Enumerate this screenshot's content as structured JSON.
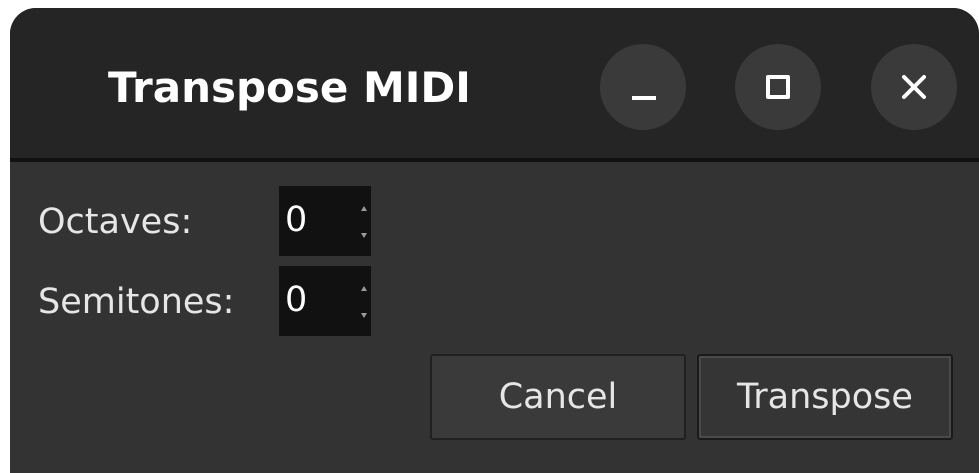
{
  "window": {
    "title": "Transpose MIDI"
  },
  "form": {
    "octaves": {
      "label": "Octaves:",
      "value": "0"
    },
    "semitones": {
      "label": "Semitones:",
      "value": "0"
    }
  },
  "actions": {
    "cancel_label": "Cancel",
    "transpose_label": "Transpose"
  },
  "icons": {
    "minimize": "minimize-icon",
    "maximize": "maximize-icon",
    "close": "close-icon"
  },
  "colors": {
    "titlebar": "#252525",
    "body": "#333333",
    "input_bg": "#111111",
    "button_bg": "#3a3a3a",
    "text": "#e6e6e6"
  }
}
